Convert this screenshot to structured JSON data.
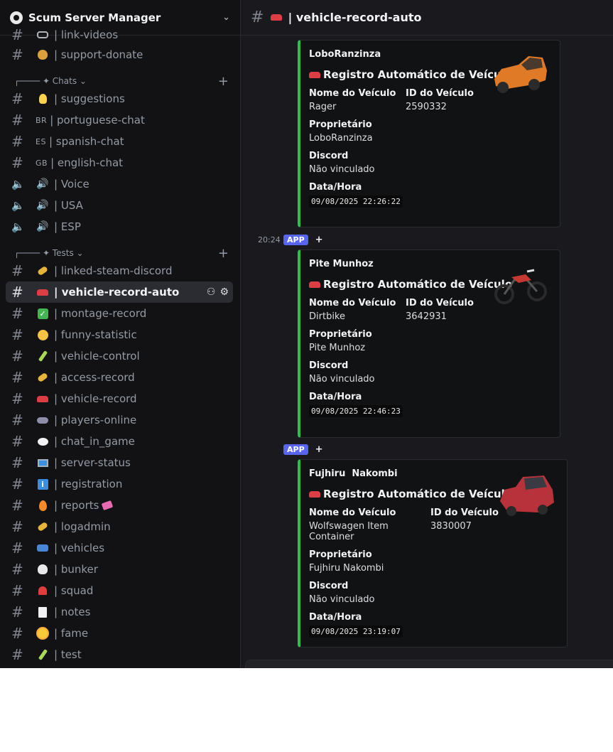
{
  "server": {
    "name": "Scum Server Manager",
    "icon": "server-icon"
  },
  "sidebar": {
    "partial_top": "| link-videos",
    "categories": [
      {
        "label": "┌──── ✦ Chats ⌄"
      },
      {
        "label": "┌──── ✦ Tests ⌄"
      }
    ],
    "channels": [
      {
        "icon": "money-bag-icon",
        "name": "| support-donate"
      },
      {
        "icon": "lightbulb-icon",
        "name": "| suggestions"
      },
      {
        "flag": "BR",
        "name": "| portuguese-chat"
      },
      {
        "flag": "ES",
        "name": "| spanish-chat"
      },
      {
        "flag": "GB",
        "name": "| english-chat"
      },
      {
        "icon": "speaker-icon",
        "name": "| Voice"
      },
      {
        "icon": "speaker-icon",
        "name": "| USA"
      },
      {
        "icon": "speaker-icon",
        "name": "| ESP"
      },
      {
        "icon": "key-icon",
        "name": "| linked-steam-discord"
      },
      {
        "icon": "car-icon",
        "name": "| vehicle-record-auto"
      },
      {
        "icon": "check-icon",
        "name": "| montage-record"
      },
      {
        "icon": "grin-icon",
        "name": "| funny-statistic"
      },
      {
        "icon": "test-tube-icon",
        "name": "| vehicle-control"
      },
      {
        "icon": "key-icon",
        "name": "| access-record"
      },
      {
        "icon": "car-icon",
        "name": "| vehicle-record"
      },
      {
        "icon": "gamepad-icon",
        "name": "| players-online"
      },
      {
        "icon": "speech-bubble-icon",
        "name": "| chat_in_game"
      },
      {
        "icon": "monitor-icon",
        "name": "| server-status"
      },
      {
        "icon": "info-icon",
        "name": "| registration"
      },
      {
        "icon": "fire-icon",
        "name": "| reports"
      },
      {
        "icon": "key-icon",
        "name": "| logadmin"
      },
      {
        "icon": "van-icon",
        "name": "| vehicles"
      },
      {
        "icon": "skull-icon",
        "name": "| bunker"
      },
      {
        "icon": "siren-icon",
        "name": "| squad"
      },
      {
        "icon": "memo-icon",
        "name": "| notes"
      },
      {
        "icon": "sun-icon",
        "name": "| fame"
      },
      {
        "icon": "test-tube-icon",
        "name": "| test"
      }
    ]
  },
  "header": {
    "channel_name": "| vehicle-record-auto"
  },
  "messages": [
    {
      "author": "LoboRanzinza",
      "title": "Registro Automático de Veículo",
      "vehicle_label": "Nome do Veículo",
      "vehicle": "Rager",
      "id_label": "ID do Veículo",
      "id": "2590332",
      "owner_label": "Proprietário",
      "owner": "LoboRanzinza",
      "discord_label": "Discord",
      "discord": "Não vinculado",
      "datetime_label": "Data/Hora",
      "datetime": "09/08/2025 22:26:22",
      "thumb_color": "#e07a26"
    },
    {
      "time": "20:24",
      "badge": "APP",
      "plus": "+",
      "author": "Pite Munhoz",
      "title": "Registro Automático de Veículo",
      "vehicle_label": "Nome do Veículo",
      "vehicle": "Dirtbike",
      "id_label": "ID do Veículo",
      "id": "3642931",
      "owner_label": "Proprietário",
      "owner": "Pite Munhoz",
      "discord_label": "Discord",
      "discord": "Não vinculado",
      "datetime_label": "Data/Hora",
      "datetime": "09/08/2025 22:46:23",
      "thumb_color": "#c43a32"
    },
    {
      "badge": "APP",
      "plus": "+",
      "author": "Fujhiru  Nakombi",
      "title": "Registro Automático de Veículo",
      "vehicle_label": "Nome do Veículo",
      "vehicle": "Wolfswagen Item Container",
      "id_label": "ID do Veículo",
      "id": "3830007",
      "owner_label": "Proprietário",
      "owner": "Fujhiru Nakombi",
      "discord_label": "Discord",
      "discord": "Não vinculado",
      "datetime_label": "Data/Hora",
      "datetime": "09/08/2025 23:19:07",
      "thumb_color": "#b8323b"
    }
  ],
  "colors": {
    "embed_accent": "#2cbf4d",
    "app_badge": "#5865f2"
  }
}
